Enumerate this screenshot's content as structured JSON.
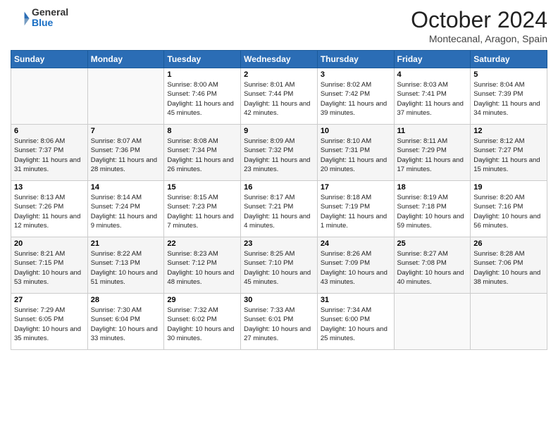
{
  "logo": {
    "text_general": "General",
    "text_blue": "Blue"
  },
  "header": {
    "month": "October 2024",
    "location": "Montecanal, Aragon, Spain"
  },
  "weekdays": [
    "Sunday",
    "Monday",
    "Tuesday",
    "Wednesday",
    "Thursday",
    "Friday",
    "Saturday"
  ],
  "weeks": [
    [
      {
        "day": "",
        "info": ""
      },
      {
        "day": "",
        "info": ""
      },
      {
        "day": "1",
        "info": "Sunrise: 8:00 AM\nSunset: 7:46 PM\nDaylight: 11 hours and 45 minutes."
      },
      {
        "day": "2",
        "info": "Sunrise: 8:01 AM\nSunset: 7:44 PM\nDaylight: 11 hours and 42 minutes."
      },
      {
        "day": "3",
        "info": "Sunrise: 8:02 AM\nSunset: 7:42 PM\nDaylight: 11 hours and 39 minutes."
      },
      {
        "day": "4",
        "info": "Sunrise: 8:03 AM\nSunset: 7:41 PM\nDaylight: 11 hours and 37 minutes."
      },
      {
        "day": "5",
        "info": "Sunrise: 8:04 AM\nSunset: 7:39 PM\nDaylight: 11 hours and 34 minutes."
      }
    ],
    [
      {
        "day": "6",
        "info": "Sunrise: 8:06 AM\nSunset: 7:37 PM\nDaylight: 11 hours and 31 minutes."
      },
      {
        "day": "7",
        "info": "Sunrise: 8:07 AM\nSunset: 7:36 PM\nDaylight: 11 hours and 28 minutes."
      },
      {
        "day": "8",
        "info": "Sunrise: 8:08 AM\nSunset: 7:34 PM\nDaylight: 11 hours and 26 minutes."
      },
      {
        "day": "9",
        "info": "Sunrise: 8:09 AM\nSunset: 7:32 PM\nDaylight: 11 hours and 23 minutes."
      },
      {
        "day": "10",
        "info": "Sunrise: 8:10 AM\nSunset: 7:31 PM\nDaylight: 11 hours and 20 minutes."
      },
      {
        "day": "11",
        "info": "Sunrise: 8:11 AM\nSunset: 7:29 PM\nDaylight: 11 hours and 17 minutes."
      },
      {
        "day": "12",
        "info": "Sunrise: 8:12 AM\nSunset: 7:27 PM\nDaylight: 11 hours and 15 minutes."
      }
    ],
    [
      {
        "day": "13",
        "info": "Sunrise: 8:13 AM\nSunset: 7:26 PM\nDaylight: 11 hours and 12 minutes."
      },
      {
        "day": "14",
        "info": "Sunrise: 8:14 AM\nSunset: 7:24 PM\nDaylight: 11 hours and 9 minutes."
      },
      {
        "day": "15",
        "info": "Sunrise: 8:15 AM\nSunset: 7:23 PM\nDaylight: 11 hours and 7 minutes."
      },
      {
        "day": "16",
        "info": "Sunrise: 8:17 AM\nSunset: 7:21 PM\nDaylight: 11 hours and 4 minutes."
      },
      {
        "day": "17",
        "info": "Sunrise: 8:18 AM\nSunset: 7:19 PM\nDaylight: 11 hours and 1 minute."
      },
      {
        "day": "18",
        "info": "Sunrise: 8:19 AM\nSunset: 7:18 PM\nDaylight: 10 hours and 59 minutes."
      },
      {
        "day": "19",
        "info": "Sunrise: 8:20 AM\nSunset: 7:16 PM\nDaylight: 10 hours and 56 minutes."
      }
    ],
    [
      {
        "day": "20",
        "info": "Sunrise: 8:21 AM\nSunset: 7:15 PM\nDaylight: 10 hours and 53 minutes."
      },
      {
        "day": "21",
        "info": "Sunrise: 8:22 AM\nSunset: 7:13 PM\nDaylight: 10 hours and 51 minutes."
      },
      {
        "day": "22",
        "info": "Sunrise: 8:23 AM\nSunset: 7:12 PM\nDaylight: 10 hours and 48 minutes."
      },
      {
        "day": "23",
        "info": "Sunrise: 8:25 AM\nSunset: 7:10 PM\nDaylight: 10 hours and 45 minutes."
      },
      {
        "day": "24",
        "info": "Sunrise: 8:26 AM\nSunset: 7:09 PM\nDaylight: 10 hours and 43 minutes."
      },
      {
        "day": "25",
        "info": "Sunrise: 8:27 AM\nSunset: 7:08 PM\nDaylight: 10 hours and 40 minutes."
      },
      {
        "day": "26",
        "info": "Sunrise: 8:28 AM\nSunset: 7:06 PM\nDaylight: 10 hours and 38 minutes."
      }
    ],
    [
      {
        "day": "27",
        "info": "Sunrise: 7:29 AM\nSunset: 6:05 PM\nDaylight: 10 hours and 35 minutes."
      },
      {
        "day": "28",
        "info": "Sunrise: 7:30 AM\nSunset: 6:04 PM\nDaylight: 10 hours and 33 minutes."
      },
      {
        "day": "29",
        "info": "Sunrise: 7:32 AM\nSunset: 6:02 PM\nDaylight: 10 hours and 30 minutes."
      },
      {
        "day": "30",
        "info": "Sunrise: 7:33 AM\nSunset: 6:01 PM\nDaylight: 10 hours and 27 minutes."
      },
      {
        "day": "31",
        "info": "Sunrise: 7:34 AM\nSunset: 6:00 PM\nDaylight: 10 hours and 25 minutes."
      },
      {
        "day": "",
        "info": ""
      },
      {
        "day": "",
        "info": ""
      }
    ]
  ]
}
